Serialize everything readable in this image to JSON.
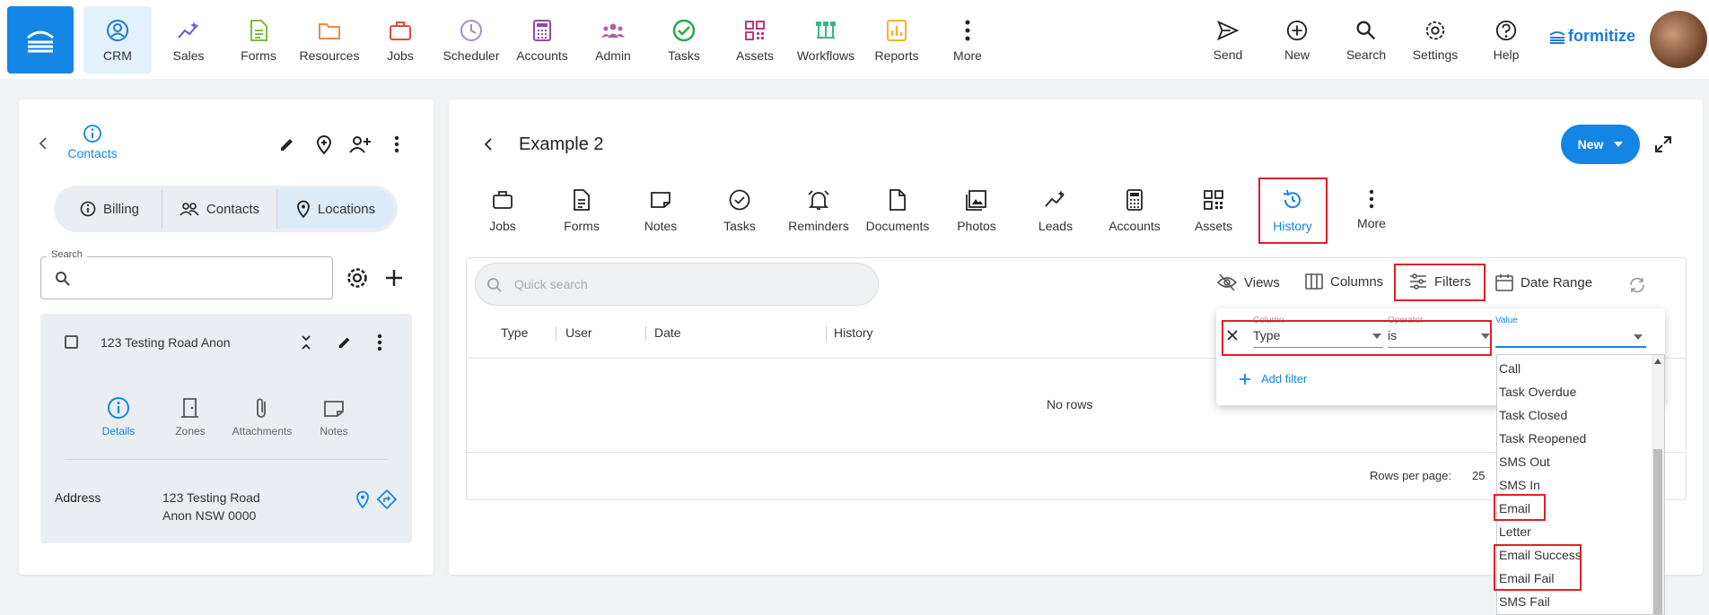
{
  "nav": {
    "items": [
      {
        "label": "CRM",
        "icon": "crm-icon"
      },
      {
        "label": "Sales",
        "icon": "sales-icon"
      },
      {
        "label": "Forms",
        "icon": "forms-icon"
      },
      {
        "label": "Resources",
        "icon": "folder-icon"
      },
      {
        "label": "Jobs",
        "icon": "briefcase-icon"
      },
      {
        "label": "Scheduler",
        "icon": "clock-icon"
      },
      {
        "label": "Accounts",
        "icon": "calculator-icon"
      },
      {
        "label": "Admin",
        "icon": "group-icon"
      },
      {
        "label": "Tasks",
        "icon": "check-circle-icon"
      },
      {
        "label": "Assets",
        "icon": "qr-icon"
      },
      {
        "label": "Workflows",
        "icon": "workflow-icon"
      },
      {
        "label": "Reports",
        "icon": "chart-icon"
      },
      {
        "label": "More",
        "icon": "more-vertical-icon"
      }
    ],
    "right": [
      {
        "label": "Send"
      },
      {
        "label": "New"
      },
      {
        "label": "Search"
      },
      {
        "label": "Settings"
      },
      {
        "label": "Help"
      }
    ],
    "logo": "formitize"
  },
  "left": {
    "info_label": "Contacts",
    "segments": [
      "Billing",
      "Contacts",
      "Locations"
    ],
    "search_label": "Search",
    "location_name": "123 Testing Road Anon",
    "sub_tabs": [
      "Details",
      "Zones",
      "Attachments",
      "Notes"
    ],
    "address_label": "Address",
    "address_line1": "123 Testing Road",
    "address_line2": "Anon NSW 0000"
  },
  "main": {
    "title": "Example 2",
    "new_label": "New",
    "tabs": [
      "Jobs",
      "Forms",
      "Notes",
      "Tasks",
      "Reminders",
      "Documents",
      "Photos",
      "Leads",
      "Accounts",
      "Assets",
      "History",
      "More"
    ],
    "search_placeholder": "Quick search",
    "toolbar": {
      "views": "Views",
      "columns": "Columns",
      "filters": "Filters",
      "date_range": "Date Range"
    },
    "columns": [
      "Type",
      "User",
      "Date",
      "History"
    ],
    "empty": "No rows",
    "rows_per_page_label": "Rows per page:",
    "rows_per_page": "25"
  },
  "filter": {
    "column_label": "Column",
    "column_value": "Type",
    "operator_label": "Operator",
    "operator_value": "is",
    "value_label": "Value",
    "add_filter": "Add filter",
    "options": [
      "Call",
      "Task Overdue",
      "Task Closed",
      "Task Reopened",
      "SMS Out",
      "SMS In",
      "Email",
      "Letter",
      "Email Success",
      "Email Fail",
      "SMS Fail"
    ]
  },
  "colors": {
    "accent": "#1385e5",
    "highlight": "#e01f26"
  }
}
